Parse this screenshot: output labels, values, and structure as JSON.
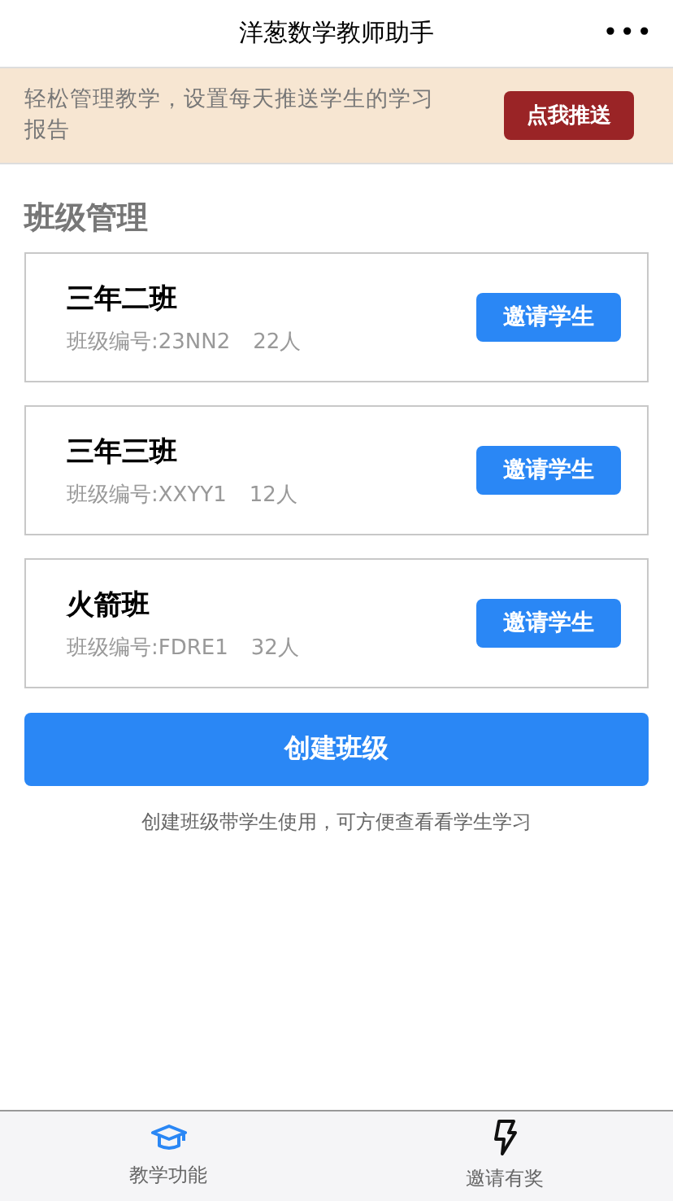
{
  "nav_bar": {
    "title": "洋葱数学教师助手",
    "more": "•••"
  },
  "banner": {
    "text": "轻松管理教学，设置每天推送学生的学习报告",
    "button": "点我推送"
  },
  "section_title": "班级管理",
  "classes": [
    {
      "name": "三年二班",
      "code": "班级编号:23NN2",
      "count": "22人",
      "button": "邀请学生"
    },
    {
      "name": "三年三班",
      "code": "班级编号:XXYY1",
      "count": "12人",
      "button": "邀请学生"
    },
    {
      "name": "火箭班",
      "code": "班级编号:FDRE1",
      "count": "32人",
      "button": "邀请学生"
    }
  ],
  "create_button": "创建班级",
  "hint": "创建班级带学生使用，可方便查看看学生学习",
  "tab_bar": [
    {
      "kind": "graduation",
      "label": "教学功能",
      "selected": true
    },
    {
      "kind": "bolt",
      "label": "邀请有奖",
      "selected": false
    }
  ]
}
